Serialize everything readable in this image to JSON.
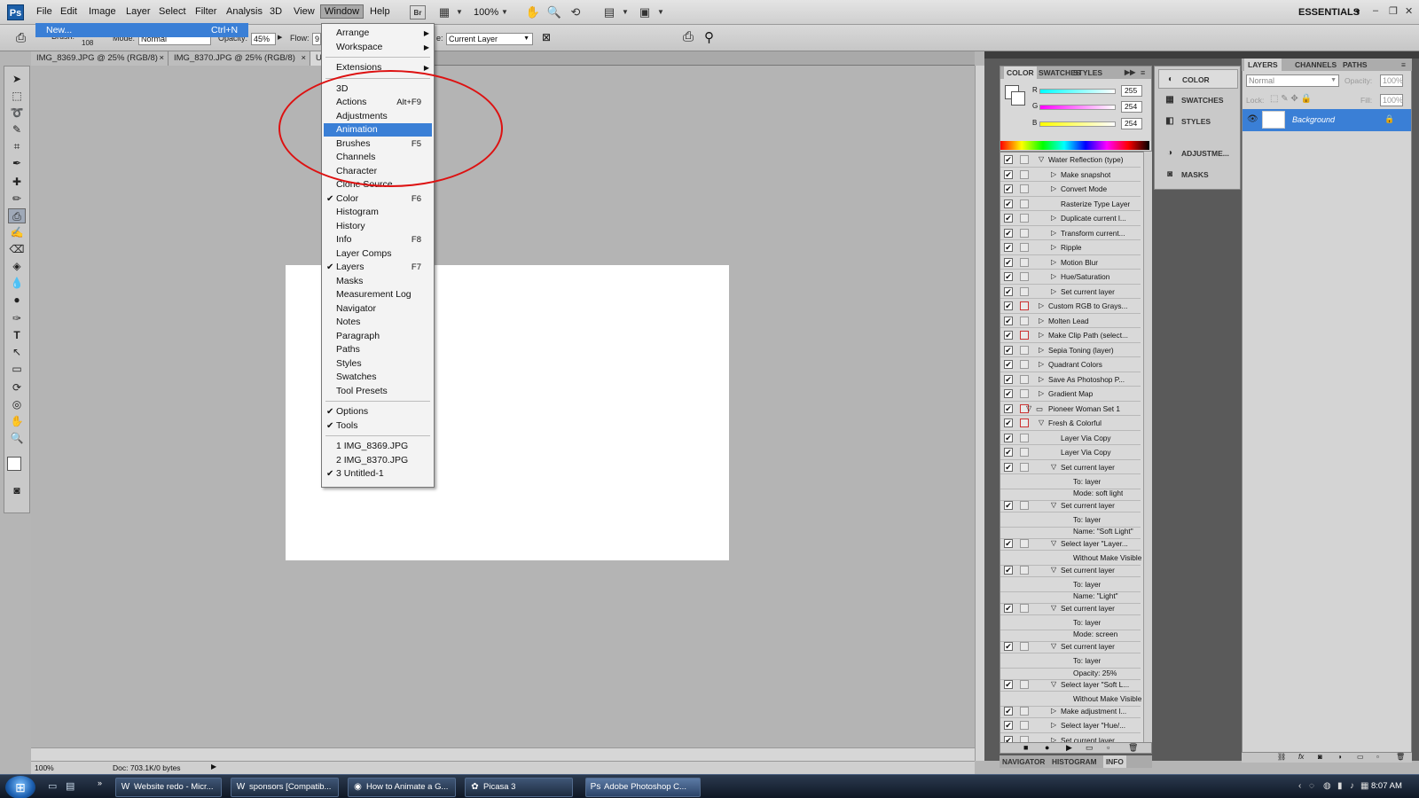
{
  "app": {
    "logo": "Ps",
    "workspace": "ESSENTIALS"
  },
  "menubar": {
    "items": [
      "File",
      "Edit",
      "Image",
      "Layer",
      "Select",
      "Filter",
      "Analysis",
      "3D",
      "View",
      "Window",
      "Help"
    ],
    "zoom": "100%"
  },
  "options": {
    "brush_label": "Brush:",
    "brush_size": "108",
    "mode_label": "Mode:",
    "mode_value": "Normal",
    "opacity_label": "Opacity:",
    "opacity_value": "45%",
    "flow_label": "Flow:",
    "flow_value": "9",
    "sample_label": "e:",
    "sample_value": "Current Layer"
  },
  "doc_tabs": [
    "IMG_8369.JPG @ 25% (RGB/8)",
    "IMG_8370.JPG @ 25% (RGB/8)",
    "U"
  ],
  "file_menu_open": {
    "label": "New...",
    "shortcut": "Ctrl+N"
  },
  "window_menu": {
    "groups": [
      [
        {
          "label": "Arrange",
          "submenu": true
        },
        {
          "label": "Workspace",
          "submenu": true
        }
      ],
      [
        {
          "label": "Extensions",
          "submenu": true
        }
      ],
      [
        {
          "label": "3D"
        },
        {
          "label": "Actions",
          "shortcut": "Alt+F9"
        },
        {
          "label": "Adjustments"
        },
        {
          "label": "Animation",
          "highlighted": true
        },
        {
          "label": "Brushes",
          "shortcut": "F5"
        },
        {
          "label": "Channels"
        },
        {
          "label": "Character"
        },
        {
          "label": "Clone Source"
        },
        {
          "label": "Color",
          "shortcut": "F6",
          "checked": true
        },
        {
          "label": "Histogram"
        },
        {
          "label": "History"
        },
        {
          "label": "Info",
          "shortcut": "F8"
        },
        {
          "label": "Layer Comps"
        },
        {
          "label": "Layers",
          "shortcut": "F7",
          "checked": true
        },
        {
          "label": "Masks"
        },
        {
          "label": "Measurement Log"
        },
        {
          "label": "Navigator"
        },
        {
          "label": "Notes"
        },
        {
          "label": "Paragraph"
        },
        {
          "label": "Paths"
        },
        {
          "label": "Styles"
        },
        {
          "label": "Swatches"
        },
        {
          "label": "Tool Presets"
        }
      ],
      [
        {
          "label": "Options",
          "checked": true
        },
        {
          "label": "Tools",
          "checked": true
        }
      ],
      [
        {
          "label": "1 IMG_8369.JPG"
        },
        {
          "label": "2 IMG_8370.JPG"
        },
        {
          "label": "3 Untitled-1",
          "checked": true
        }
      ]
    ]
  },
  "color_panel": {
    "tabs": [
      "COLOR",
      "SWATCHES",
      "STYLES"
    ],
    "r": "255",
    "g": "254",
    "b": "254",
    "r_label": "R",
    "g_label": "G",
    "b_label": "B"
  },
  "actions": [
    {
      "label": "Water Reflection (type)",
      "indent": 1,
      "expanded": true,
      "check": true,
      "dialog": false
    },
    {
      "label": "Make snapshot",
      "indent": 2,
      "check": true
    },
    {
      "label": "Convert Mode",
      "indent": 2,
      "check": true
    },
    {
      "label": "Rasterize Type Layer",
      "indent": 2,
      "check": true,
      "leaf": true
    },
    {
      "label": "Duplicate current l...",
      "indent": 2,
      "check": true
    },
    {
      "label": "Transform current...",
      "indent": 2,
      "check": true
    },
    {
      "label": "Ripple",
      "indent": 2,
      "check": true
    },
    {
      "label": "Motion Blur",
      "indent": 2,
      "check": true
    },
    {
      "label": "Hue/Saturation",
      "indent": 2,
      "check": true
    },
    {
      "label": "Set current layer",
      "indent": 2,
      "check": true
    },
    {
      "label": "Custom RGB to Grays...",
      "indent": 1,
      "check": true,
      "dialog": "red"
    },
    {
      "label": "Molten Lead",
      "indent": 1,
      "check": true
    },
    {
      "label": "Make Clip Path (select...",
      "indent": 1,
      "check": true,
      "dialog": "red"
    },
    {
      "label": "Sepia Toning (layer)",
      "indent": 1,
      "check": true
    },
    {
      "label": "Quadrant Colors",
      "indent": 1,
      "check": true
    },
    {
      "label": "Save As Photoshop P...",
      "indent": 1,
      "check": true,
      "dialog": "grey"
    },
    {
      "label": "Gradient Map",
      "indent": 1,
      "check": true
    },
    {
      "label": "Pioneer Woman Set 1",
      "indent": 0,
      "expanded": true,
      "check": true,
      "dialog": "red",
      "folder": true
    },
    {
      "label": "Fresh & Colorful",
      "indent": 1,
      "expanded": true,
      "check": true,
      "dialog": "red"
    },
    {
      "label": "Layer Via Copy",
      "indent": 2,
      "check": true,
      "leaf": true
    },
    {
      "label": "Layer Via Copy",
      "indent": 2,
      "check": true,
      "leaf": true
    },
    {
      "label": "Set current layer",
      "indent": 2,
      "expanded": true,
      "check": true
    },
    {
      "label": "To: layer",
      "indent": 3,
      "sub": true
    },
    {
      "label": "Mode: soft light",
      "indent": 3,
      "sub": true
    },
    {
      "label": "Set current layer",
      "indent": 2,
      "expanded": true,
      "check": true
    },
    {
      "label": "To: layer",
      "indent": 3,
      "sub": true
    },
    {
      "label": "Name:  \"Soft Light\"",
      "indent": 3,
      "sub": true
    },
    {
      "label": "Select layer \"Layer...",
      "indent": 2,
      "expanded": true,
      "check": true
    },
    {
      "label": "Without Make Visible",
      "indent": 3,
      "sub": true
    },
    {
      "label": "Set current layer",
      "indent": 2,
      "expanded": true,
      "check": true
    },
    {
      "label": "To: layer",
      "indent": 3,
      "sub": true
    },
    {
      "label": "Name:  \"Light\"",
      "indent": 3,
      "sub": true
    },
    {
      "label": "Set current layer",
      "indent": 2,
      "expanded": true,
      "check": true
    },
    {
      "label": "To: layer",
      "indent": 3,
      "sub": true
    },
    {
      "label": "Mode: screen",
      "indent": 3,
      "sub": true
    },
    {
      "label": "Set current layer",
      "indent": 2,
      "expanded": true,
      "check": true
    },
    {
      "label": "To: layer",
      "indent": 3,
      "sub": true
    },
    {
      "label": "Opacity: 25%",
      "indent": 3,
      "sub": true
    },
    {
      "label": "Select layer \"Soft L...",
      "indent": 2,
      "expanded": true,
      "check": true
    },
    {
      "label": "Without Make Visible",
      "indent": 3,
      "sub": true
    },
    {
      "label": "Make adjustment l...",
      "indent": 2,
      "check": true
    },
    {
      "label": "Select layer \"Hue/...",
      "indent": 2,
      "check": true
    },
    {
      "label": "Set current layer",
      "indent": 2,
      "check": true
    }
  ],
  "bottom_tabs": [
    "NAVIGATOR",
    "HISTOGRAM",
    "INFO"
  ],
  "dock": [
    "COLOR",
    "SWATCHES",
    "STYLES",
    "ADJUSTME...",
    "MASKS"
  ],
  "layers": {
    "tabs": [
      "LAYERS",
      "CHANNELS",
      "PATHS"
    ],
    "blend": "Normal",
    "opacity_label": "Opacity:",
    "opacity": "100%",
    "lock_label": "Lock:",
    "fill_label": "Fill:",
    "fill": "100%",
    "layer_name": "Background"
  },
  "status": {
    "zoom": "100%",
    "doc": "Doc: 703.1K/0 bytes"
  },
  "taskbar": {
    "buttons": [
      "Website redo - Micr...",
      "sponsors [Compatib...",
      "How to Animate a G...",
      "Picasa 3",
      "Adobe Photoshop C..."
    ],
    "clock": "8:07 AM"
  }
}
